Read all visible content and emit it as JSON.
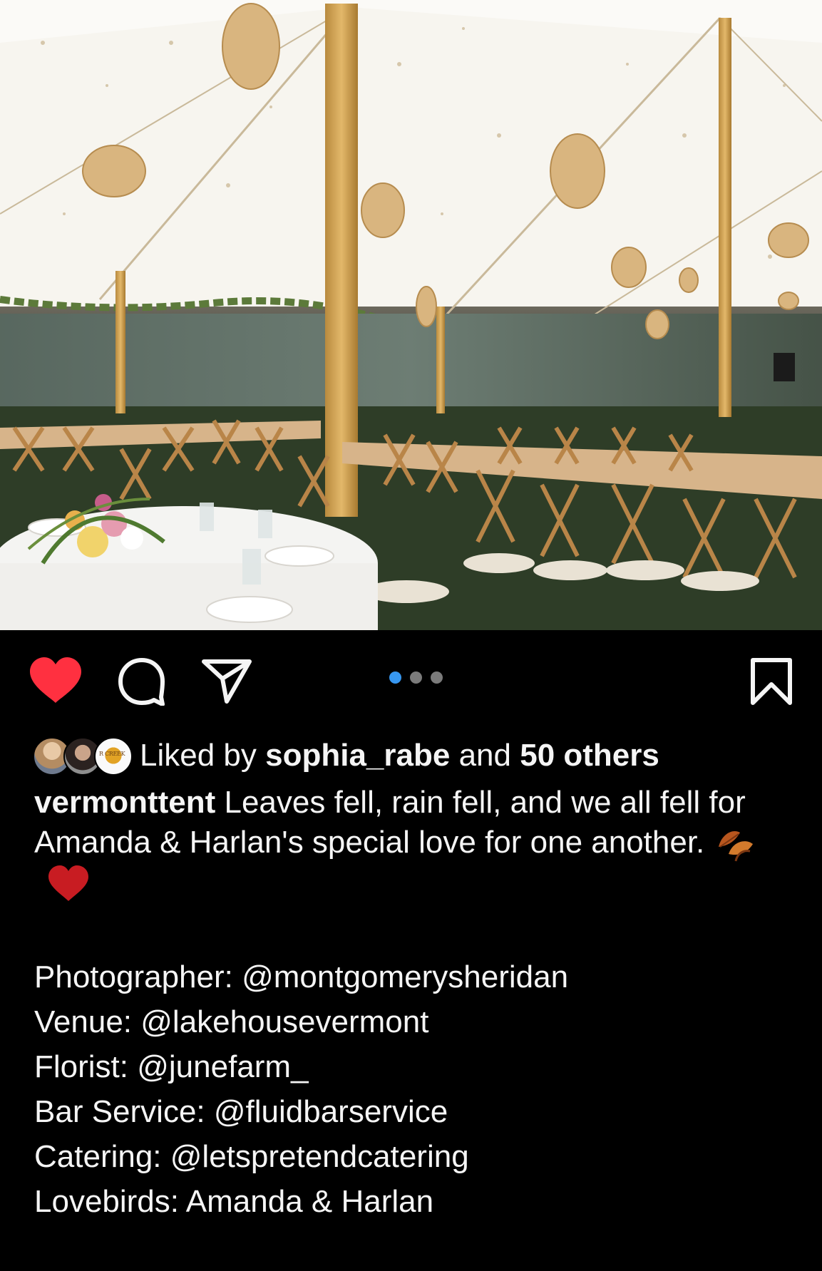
{
  "post": {
    "image_label": "Tented wedding reception with rattan pendant lanterns, crossback wooden chairs and floral centerpieces",
    "carousel": {
      "count": 3,
      "active_index": 0
    },
    "liked": true,
    "accent_color": "#ff3040",
    "dot_active_color": "#3797f0"
  },
  "actions": {
    "like_icon": "heart-filled-icon",
    "comment_icon": "comment-icon",
    "share_icon": "send-icon",
    "save_icon": "bookmark-icon"
  },
  "likes": {
    "prefix": "Liked by",
    "user": "sophia_rabe",
    "middle": "and",
    "others": "50 others",
    "avatar_badge_text": "R CREEK"
  },
  "caption": {
    "username": "vermonttent",
    "text": "Leaves fell, rain fell, and we all fell for Amanda & Harlan's special love for one another.",
    "emojis": [
      "fallen-leaf-emoji",
      "red-heart-emoji"
    ],
    "credits": [
      "Photographer: @montgomerysheridan",
      "Venue: @lakehousevermont",
      "Florist: @junefarm_",
      "Bar Service: @fluidbarservice",
      "Catering: @letspretendcatering",
      "Lovebirds: Amanda & Harlan"
    ]
  }
}
